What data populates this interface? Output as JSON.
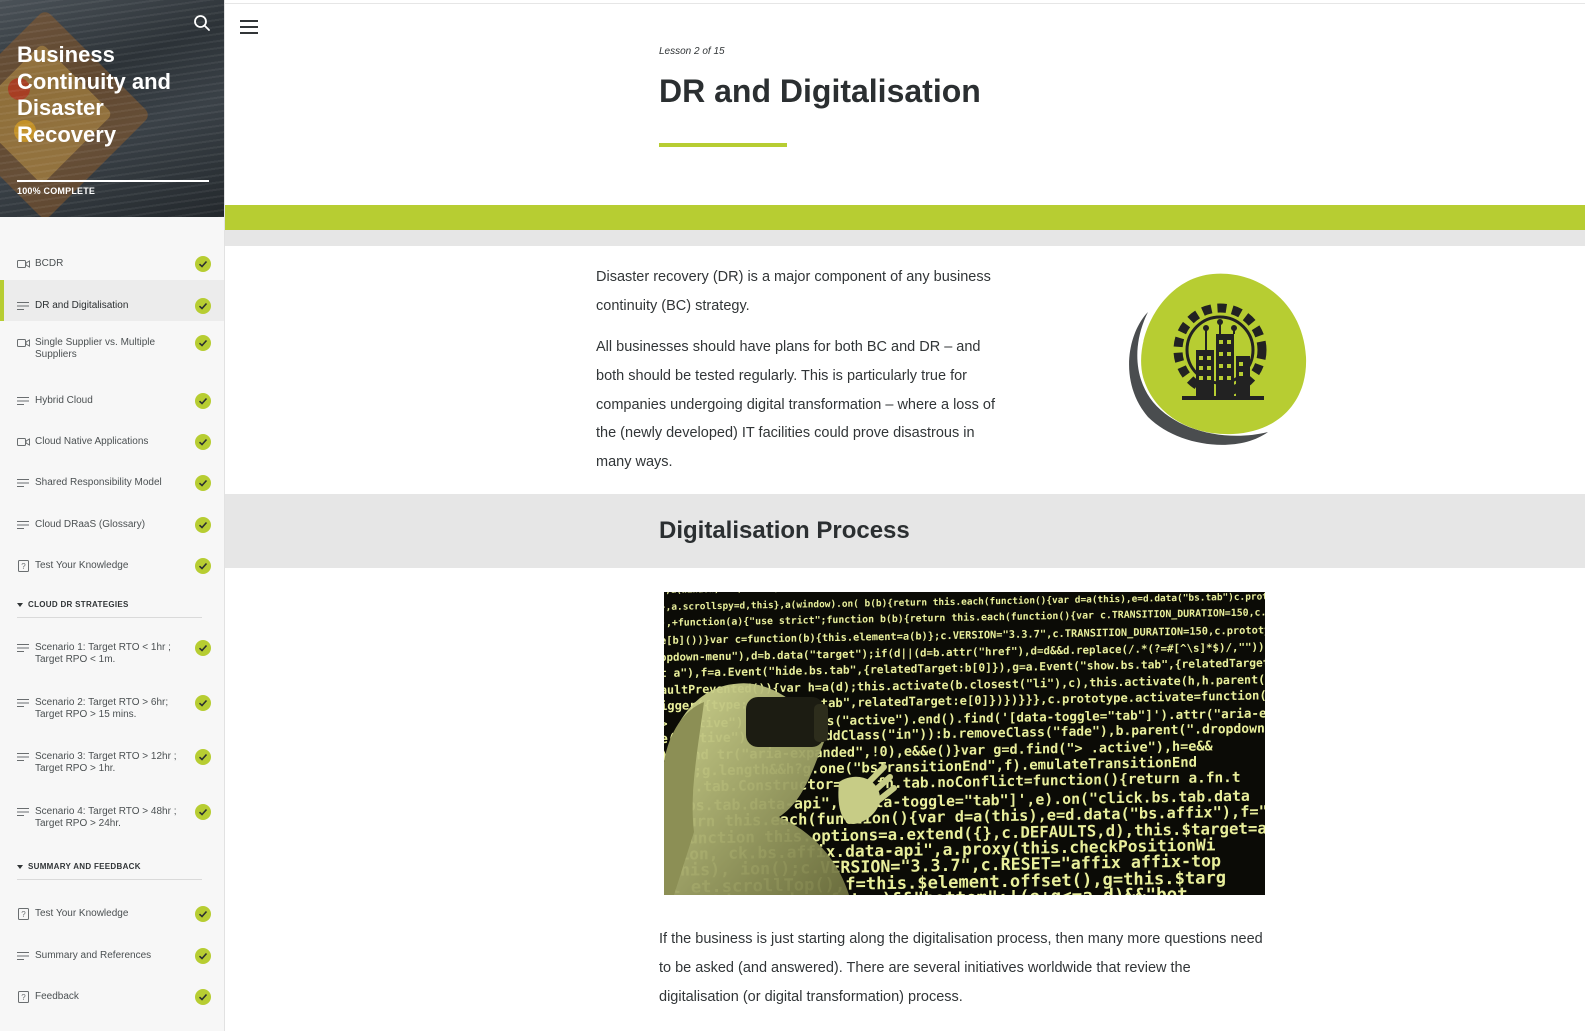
{
  "sidebar": {
    "course_title": "Business Continuity and Disaster Recovery",
    "progress_text": "100% COMPLETE",
    "progress_fraction": 1.0,
    "search_icon": "search-icon",
    "items": [
      {
        "label": "BCDR",
        "icon": "video-icon",
        "completed": true
      },
      {
        "label": "DR and Digitalisation",
        "icon": "text-lines-icon",
        "completed": true,
        "active": true
      },
      {
        "label": "Single Supplier vs. Multiple Suppliers",
        "icon": "video-icon",
        "completed": true
      },
      {
        "label": "Hybrid Cloud",
        "icon": "text-lines-icon",
        "completed": true
      },
      {
        "label": "Cloud Native Applications",
        "icon": "video-icon",
        "completed": true
      },
      {
        "label": "Shared Responsibility Model",
        "icon": "text-lines-icon",
        "completed": true
      },
      {
        "label": "Cloud DRaaS (Glossary)",
        "icon": "text-lines-icon",
        "completed": true
      },
      {
        "label": "Test Your Knowledge",
        "icon": "quiz-icon",
        "completed": true
      }
    ],
    "sections": [
      {
        "title": "CLOUD DR STRATEGIES",
        "items": [
          {
            "label": "Scenario 1: Target RTO < 1hr ; Target RPO < 1m.",
            "icon": "text-lines-icon",
            "completed": true
          },
          {
            "label": "Scenario 2: Target RTO > 6hr; Target RPO > 15 mins.",
            "icon": "text-lines-icon",
            "completed": true
          },
          {
            "label": "Scenario 3: Target RTO > 12hr ; Target RPO > 1hr.",
            "icon": "text-lines-icon",
            "completed": true
          },
          {
            "label": "Scenario 4: Target RTO > 48hr ; Target RPO > 24hr.",
            "icon": "text-lines-icon",
            "completed": true
          }
        ]
      },
      {
        "title": "SUMMARY AND FEEDBACK",
        "items": [
          {
            "label": "Test Your Knowledge",
            "icon": "quiz-icon",
            "completed": true
          },
          {
            "label": "Summary and References",
            "icon": "text-lines-icon",
            "completed": true
          },
          {
            "label": "Feedback",
            "icon": "quiz-icon",
            "completed": true
          }
        ]
      }
    ]
  },
  "lesson": {
    "count": "Lesson 2 of 15",
    "title": "DR and Digitalisation",
    "paragraphs": [
      "Disaster recovery (DR) is a major component of any business continuity (BC) strategy.",
      "All businesses should have plans for both BC and DR – and both should be tested regularly. This is particularly true for companies undergoing digital transformation – where a loss of the (newly developed) IT facilities could prove disastrous in many ways."
    ],
    "section_title": "Digitalisation Process",
    "closing_paragraph": "If the business is just starting along the digitalisation process, then many more questions need to be asked (and answered). There are several initiatives worldwide that review the digitalisation (or digital transformation) process."
  },
  "image_code_lines": [
    "},a(window).on( load ,function(){a( [data-spy=\"scroll\"]').each(function(){var b=a(this);c.call(",
    "},a.scrollspy=d,this},a(window).on( b(b){return this.each(function(){var d=a(this),e=d.data(\"bs.tab\")c.prot",
    "),+function(a){\"use strict\";function b(b){return this.each(function(){var c.TRANSITION_DURATION=150,c.prot",
    "e[b]())}var c=function(b){this.element=a(b)};c.VERSION=\"3.3.7\",c.TRANSITION_DURATION=150,c.prototype.show",
    "opdown-menu\"),d=b.data(\"target\");if(d||(d=b.attr(\"href\"),d=d&&d.replace(/.*(?=#[^\\s]*$)/,\"\")),!",
    "t a\"),f=a.Event(\"hide.bs.tab\",{relatedTarget:b[0]}),g=a.Event(\"show.bs.tab\",{relatedTarget:e[0]",
    "aultPrevented()){var h=a(d);this.activate(b.closest(\"li\"),c),this.activate(h,h.parent(),function",
    "igger({type:\"shown.bs.tab\",relatedTarget:e[0]})})}}},c.prototype.activate=function(b,d,e){func",
    "> .active\").removeClass(\"active\").end().find('[data-toggle=\"tab\"]').attr(\"aria-expanded\",!1),",
    "e(\"active\"),width,b.addClass(\"in\")):b.removeClass(\"fade\"),b.parent(\".dropdown-menu\")",
    ").find   tr(\"aria-expanded\",!0),e&&e()}var g=d.find(\"> .active\"),h=e&&",
    "  )||    ;g.length&&h?g.one(\"bsTransitionEnd\",f).emulateTransitionEnd",
    "       a.fn.tab.Constructor=c,a.fn.tab.noConflict=function(){return a.fn.t",
    "       ck.bs.tab.data-api\",'[data-toggle=\"tab\"]',e).on(\"click.bs.tab.data",
    "       return this.each(function(){var d=a(this),e=d.data(\"bs.affix\"),f=\"obj",
    "       c=function   this.options=a.extend({},c.DEFAULTS,d),this.$target=a",
    "       ition,       ck.bs.affix.data-api\",a.proxy(this.checkPositionWi",
    "       ,this),      ion();c.VERSION=\"3.3.7\",c.RESET=\"affix affix-top",
    "       ll           et.scrollTop(),f=this.$element.offset(),g=this.$targ",
    "                    !(e+this.unpin<=f.top)&&\"bottom\":!(e+g<=a-d)&&\"bot"
  ]
}
